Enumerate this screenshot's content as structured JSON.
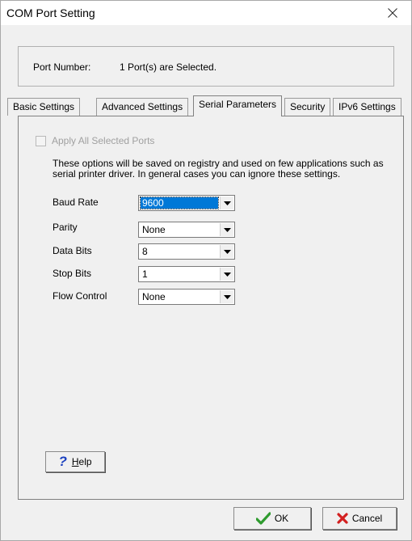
{
  "window": {
    "title": "COM Port Setting"
  },
  "port": {
    "label": "Port Number:",
    "value": "1 Port(s) are Selected."
  },
  "tabs": [
    {
      "label": "Basic Settings"
    },
    {
      "label": "Advanced Settings"
    },
    {
      "label": "Serial Parameters",
      "active": true
    },
    {
      "label": "Security"
    },
    {
      "label": "IPv6 Settings"
    }
  ],
  "panel": {
    "apply_all_label": "Apply All Selected Ports",
    "description": "These options will be saved on registry and used on few applications such as serial printer driver. In general cases you can ignore these settings.",
    "fields": [
      {
        "label": "Baud Rate",
        "value": "9600"
      },
      {
        "label": "Parity",
        "value": "None"
      },
      {
        "label": "Data Bits",
        "value": "8"
      },
      {
        "label": "Stop Bits",
        "value": "1"
      },
      {
        "label": "Flow Control",
        "value": "None"
      }
    ],
    "help_label_prefix": "",
    "help_label_underlined": "H",
    "help_label_rest": "elp"
  },
  "buttons": {
    "ok": "OK",
    "cancel": "Cancel"
  },
  "colors": {
    "selection": "#0078d7",
    "ok_check": "#2e9b2e",
    "cancel_x": "#d32020",
    "help_icon": "#1a3fbf"
  },
  "icons": {
    "close": "close-icon",
    "help": "help-question-icon",
    "ok": "checkmark-icon",
    "cancel": "x-icon",
    "dropdown": "chevron-down-icon"
  }
}
